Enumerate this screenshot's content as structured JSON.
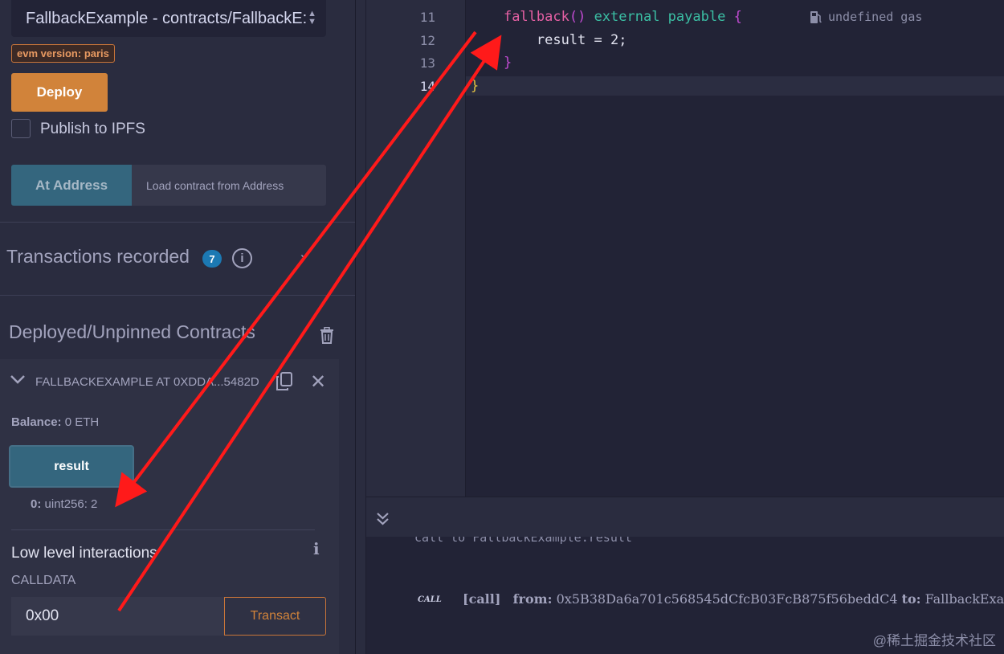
{
  "deploy_panel": {
    "contract_select_value": "FallbackExample - contracts/FallbackE:",
    "evm_badge": "evm version: paris",
    "deploy_label": "Deploy",
    "publish_label": "Publish to IPFS",
    "at_address_label": "At Address",
    "at_address_placeholder": "Load contract from Address"
  },
  "transactions": {
    "title": "Transactions recorded",
    "count": "7",
    "info_glyph": "i",
    "chevron_glyph": "›"
  },
  "deployed": {
    "title": "Deployed/Unpinned Contracts",
    "instance": {
      "name": "FALLBACKEXAMPLE AT 0XDDA...5482D",
      "close_glyph": "✕",
      "balance_label": "Balance:",
      "balance_value": "0 ETH",
      "result_button": "result",
      "output_index": "0:",
      "output_value": "uint256: 2",
      "low_level_title": "Low level interactions",
      "low_level_info": "i",
      "calldata_label": "CALLDATA",
      "calldata_value": "0x00",
      "transact_label": "Transact"
    }
  },
  "editor": {
    "lines": [
      {
        "number": "11",
        "parts": [
          {
            "text": "    ",
            "cls": ""
          },
          {
            "text": "fallback",
            "cls": "kw-fn"
          },
          {
            "text": "()",
            "cls": "kw-pun"
          },
          {
            "text": " external payable ",
            "cls": "kw-ext"
          },
          {
            "text": "{",
            "cls": "kw-pun"
          }
        ]
      },
      {
        "number": "12",
        "parts": [
          {
            "text": "        result = 2;",
            "cls": ""
          }
        ]
      },
      {
        "number": "13",
        "parts": [
          {
            "text": "    ",
            "cls": ""
          },
          {
            "text": "}",
            "cls": "kw-pun"
          }
        ]
      },
      {
        "number": "14",
        "parts": [
          {
            "text": "}",
            "cls": "kw-brace"
          }
        ]
      }
    ],
    "gas_hint": "undefined gas"
  },
  "terminal": {
    "cut_line": "call to FallbackExample.result",
    "call_icon": "CALL",
    "call_tag": "[call]",
    "from_label": "from:",
    "from_value": "0x5B38Da6a701c568545dCfcB03FcB875f56beddC4",
    "to_label": "to:",
    "to_value": "FallbackExampl"
  },
  "watermark": "@稀土掘金技术社区",
  "colors": {
    "annotation_arrow": "#ff1a1a",
    "accent_orange": "#d1833a",
    "accent_teal": "#34667e"
  }
}
